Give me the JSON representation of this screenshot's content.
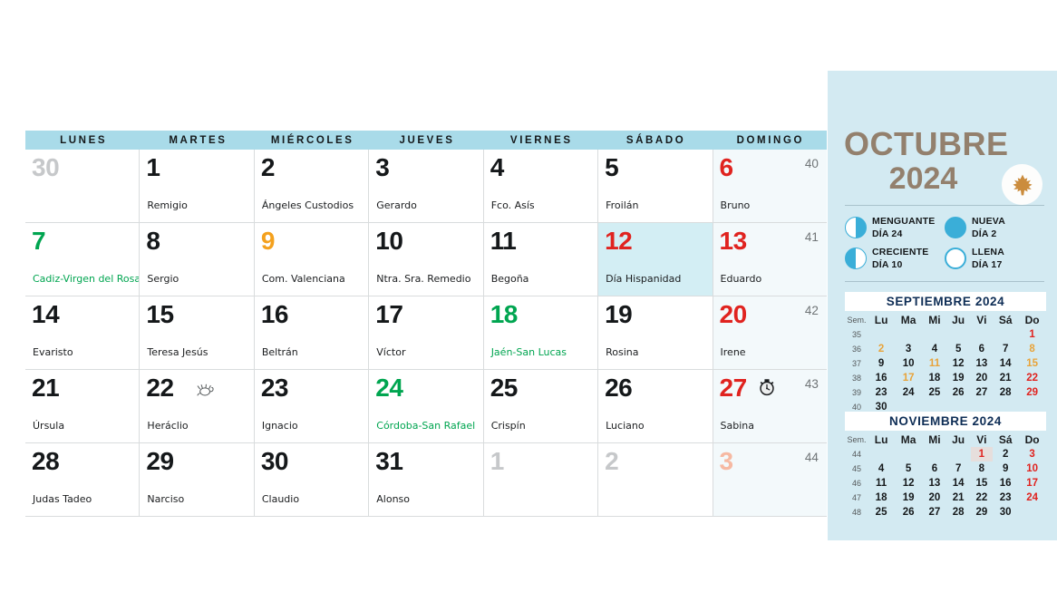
{
  "grid": {
    "weekday_headers": [
      "LUNES",
      "MARTES",
      "MIÉRCOLES",
      "JUEVES",
      "VIERNES",
      "SÁBADO",
      "DOMINGO"
    ],
    "weeks": [
      {
        "number": "40",
        "days": [
          {
            "num": "30",
            "saint": "",
            "color": "grey",
            "saint_color": "",
            "bg": "",
            "icon": ""
          },
          {
            "num": "1",
            "saint": "Remigio",
            "color": "",
            "saint_color": "",
            "bg": "",
            "icon": ""
          },
          {
            "num": "2",
            "saint": "Ángeles Custodios",
            "color": "",
            "saint_color": "",
            "bg": "",
            "icon": ""
          },
          {
            "num": "3",
            "saint": "Gerardo",
            "color": "",
            "saint_color": "",
            "bg": "",
            "icon": ""
          },
          {
            "num": "4",
            "saint": "Fco. Asís",
            "color": "",
            "saint_color": "",
            "bg": "",
            "icon": ""
          },
          {
            "num": "5",
            "saint": "Froilán",
            "color": "",
            "saint_color": "",
            "bg": "",
            "icon": ""
          },
          {
            "num": "6",
            "saint": "Bruno",
            "color": "red",
            "saint_color": "",
            "bg": "sunday",
            "icon": ""
          }
        ]
      },
      {
        "number": "41",
        "days": [
          {
            "num": "7",
            "saint": "Cadiz-Virgen del Rosario",
            "color": "green",
            "saint_color": "green",
            "bg": "",
            "icon": ""
          },
          {
            "num": "8",
            "saint": "Sergio",
            "color": "",
            "saint_color": "",
            "bg": "",
            "icon": ""
          },
          {
            "num": "9",
            "saint": "Com. Valenciana",
            "color": "orange",
            "saint_color": "",
            "bg": "",
            "icon": ""
          },
          {
            "num": "10",
            "saint": "Ntra. Sra. Remedio",
            "color": "",
            "saint_color": "",
            "bg": "",
            "icon": ""
          },
          {
            "num": "11",
            "saint": "Begoña",
            "color": "",
            "saint_color": "",
            "bg": "",
            "icon": ""
          },
          {
            "num": "12",
            "saint": "Día Hispanidad",
            "color": "red",
            "saint_color": "",
            "bg": "feast",
            "icon": ""
          },
          {
            "num": "13",
            "saint": "Eduardo",
            "color": "red",
            "saint_color": "",
            "bg": "sunday",
            "icon": ""
          }
        ]
      },
      {
        "number": "42",
        "days": [
          {
            "num": "14",
            "saint": "Evaristo",
            "color": "",
            "saint_color": "",
            "bg": "",
            "icon": ""
          },
          {
            "num": "15",
            "saint": "Teresa Jesús",
            "color": "",
            "saint_color": "",
            "bg": "",
            "icon": ""
          },
          {
            "num": "16",
            "saint": "Beltrán",
            "color": "",
            "saint_color": "",
            "bg": "",
            "icon": ""
          },
          {
            "num": "17",
            "saint": "Víctor",
            "color": "",
            "saint_color": "",
            "bg": "",
            "icon": ""
          },
          {
            "num": "18",
            "saint": "Jaén-San Lucas",
            "color": "green",
            "saint_color": "green",
            "bg": "",
            "icon": ""
          },
          {
            "num": "19",
            "saint": "Rosina",
            "color": "",
            "saint_color": "",
            "bg": "",
            "icon": ""
          },
          {
            "num": "20",
            "saint": "Irene",
            "color": "red",
            "saint_color": "",
            "bg": "sunday",
            "icon": ""
          }
        ]
      },
      {
        "number": "43",
        "days": [
          {
            "num": "21",
            "saint": "Úrsula",
            "color": "",
            "saint_color": "",
            "bg": "",
            "icon": ""
          },
          {
            "num": "22",
            "saint": "Heráclio",
            "color": "",
            "saint_color": "",
            "bg": "",
            "icon": "scorpio-icon"
          },
          {
            "num": "23",
            "saint": "Ignacio",
            "color": "",
            "saint_color": "",
            "bg": "",
            "icon": ""
          },
          {
            "num": "24",
            "saint": "Córdoba-San Rafael",
            "color": "green",
            "saint_color": "green",
            "bg": "",
            "icon": ""
          },
          {
            "num": "25",
            "saint": "Crispín",
            "color": "",
            "saint_color": "",
            "bg": "",
            "icon": ""
          },
          {
            "num": "26",
            "saint": "Luciano",
            "color": "",
            "saint_color": "",
            "bg": "",
            "icon": ""
          },
          {
            "num": "27",
            "saint": "Sabina",
            "color": "red",
            "saint_color": "",
            "bg": "sunday",
            "icon": "clock-icon"
          }
        ]
      },
      {
        "number": "44",
        "days": [
          {
            "num": "28",
            "saint": "Judas Tadeo",
            "color": "",
            "saint_color": "",
            "bg": "",
            "icon": ""
          },
          {
            "num": "29",
            "saint": "Narciso",
            "color": "",
            "saint_color": "",
            "bg": "",
            "icon": ""
          },
          {
            "num": "30",
            "saint": "Claudio",
            "color": "",
            "saint_color": "",
            "bg": "",
            "icon": ""
          },
          {
            "num": "31",
            "saint": "Alonso",
            "color": "",
            "saint_color": "",
            "bg": "",
            "icon": ""
          },
          {
            "num": "1",
            "saint": "",
            "color": "grey",
            "saint_color": "",
            "bg": "",
            "icon": ""
          },
          {
            "num": "2",
            "saint": "",
            "color": "grey",
            "saint_color": "",
            "bg": "",
            "icon": ""
          },
          {
            "num": "3",
            "saint": "",
            "color": "pink",
            "saint_color": "",
            "bg": "sunday",
            "icon": ""
          }
        ]
      }
    ]
  },
  "panel": {
    "month": "OCTUBRE",
    "year": "2024",
    "season_icon": "maple-leaf-icon",
    "accent_color": "#93806d",
    "panel_bg": "#d3eaf2",
    "moon_phases": [
      {
        "name": "MENGUANTE",
        "day": "DÍA 24",
        "icon": "moon-waning-icon",
        "css": "waning"
      },
      {
        "name": "NUEVA",
        "day": "DÍA 2",
        "icon": "moon-new-icon",
        "css": "new"
      },
      {
        "name": "CRECIENTE",
        "day": "DÍA 10",
        "icon": "moon-waxing-icon",
        "css": "waxing"
      },
      {
        "name": "LLENA",
        "day": "DÍA 17",
        "icon": "moon-full-icon",
        "css": "full"
      }
    ],
    "mini_headers": [
      "Sem.",
      "Lu",
      "Ma",
      "Mi",
      "Ju",
      "Vi",
      "Sá",
      "Do"
    ],
    "mini_prev": {
      "title": "SEPTIEMBRE 2024",
      "rows": [
        {
          "sem": "35",
          "days": [
            {
              "d": "",
              "c": ""
            },
            {
              "d": "",
              "c": ""
            },
            {
              "d": "",
              "c": ""
            },
            {
              "d": "",
              "c": ""
            },
            {
              "d": "",
              "c": ""
            },
            {
              "d": "",
              "c": ""
            },
            {
              "d": "1",
              "c": "sun"
            }
          ]
        },
        {
          "sem": "36",
          "days": [
            {
              "d": "2",
              "c": "ora"
            },
            {
              "d": "3",
              "c": ""
            },
            {
              "d": "4",
              "c": ""
            },
            {
              "d": "5",
              "c": ""
            },
            {
              "d": "6",
              "c": ""
            },
            {
              "d": "7",
              "c": ""
            },
            {
              "d": "8",
              "c": "ora"
            }
          ]
        },
        {
          "sem": "37",
          "days": [
            {
              "d": "9",
              "c": ""
            },
            {
              "d": "10",
              "c": ""
            },
            {
              "d": "11",
              "c": "ora"
            },
            {
              "d": "12",
              "c": ""
            },
            {
              "d": "13",
              "c": ""
            },
            {
              "d": "14",
              "c": ""
            },
            {
              "d": "15",
              "c": "ora"
            }
          ]
        },
        {
          "sem": "38",
          "days": [
            {
              "d": "16",
              "c": ""
            },
            {
              "d": "17",
              "c": "ora"
            },
            {
              "d": "18",
              "c": ""
            },
            {
              "d": "19",
              "c": ""
            },
            {
              "d": "20",
              "c": ""
            },
            {
              "d": "21",
              "c": ""
            },
            {
              "d": "22",
              "c": "sun"
            }
          ]
        },
        {
          "sem": "39",
          "days": [
            {
              "d": "23",
              "c": ""
            },
            {
              "d": "24",
              "c": ""
            },
            {
              "d": "25",
              "c": ""
            },
            {
              "d": "26",
              "c": ""
            },
            {
              "d": "27",
              "c": ""
            },
            {
              "d": "28",
              "c": ""
            },
            {
              "d": "29",
              "c": "sun"
            }
          ]
        },
        {
          "sem": "40",
          "days": [
            {
              "d": "30",
              "c": ""
            },
            {
              "d": "",
              "c": ""
            },
            {
              "d": "",
              "c": ""
            },
            {
              "d": "",
              "c": ""
            },
            {
              "d": "",
              "c": ""
            },
            {
              "d": "",
              "c": ""
            },
            {
              "d": "",
              "c": ""
            }
          ]
        }
      ]
    },
    "mini_next": {
      "title": "NOVIEMBRE 2024",
      "rows": [
        {
          "sem": "44",
          "days": [
            {
              "d": "",
              "c": ""
            },
            {
              "d": "",
              "c": ""
            },
            {
              "d": "",
              "c": ""
            },
            {
              "d": "",
              "c": ""
            },
            {
              "d": "1",
              "c": "hl"
            },
            {
              "d": "2",
              "c": ""
            },
            {
              "d": "3",
              "c": "sun"
            }
          ]
        },
        {
          "sem": "45",
          "days": [
            {
              "d": "4",
              "c": ""
            },
            {
              "d": "5",
              "c": ""
            },
            {
              "d": "6",
              "c": ""
            },
            {
              "d": "7",
              "c": ""
            },
            {
              "d": "8",
              "c": ""
            },
            {
              "d": "9",
              "c": ""
            },
            {
              "d": "10",
              "c": "sun"
            }
          ]
        },
        {
          "sem": "46",
          "days": [
            {
              "d": "11",
              "c": ""
            },
            {
              "d": "12",
              "c": ""
            },
            {
              "d": "13",
              "c": ""
            },
            {
              "d": "14",
              "c": ""
            },
            {
              "d": "15",
              "c": ""
            },
            {
              "d": "16",
              "c": ""
            },
            {
              "d": "17",
              "c": "sun"
            }
          ]
        },
        {
          "sem": "47",
          "days": [
            {
              "d": "18",
              "c": ""
            },
            {
              "d": "19",
              "c": ""
            },
            {
              "d": "20",
              "c": ""
            },
            {
              "d": "21",
              "c": ""
            },
            {
              "d": "22",
              "c": ""
            },
            {
              "d": "23",
              "c": ""
            },
            {
              "d": "24",
              "c": "sun"
            }
          ]
        },
        {
          "sem": "48",
          "days": [
            {
              "d": "25",
              "c": ""
            },
            {
              "d": "26",
              "c": ""
            },
            {
              "d": "27",
              "c": ""
            },
            {
              "d": "28",
              "c": ""
            },
            {
              "d": "29",
              "c": ""
            },
            {
              "d": "30",
              "c": ""
            },
            {
              "d": "",
              "c": ""
            }
          ]
        }
      ]
    }
  }
}
